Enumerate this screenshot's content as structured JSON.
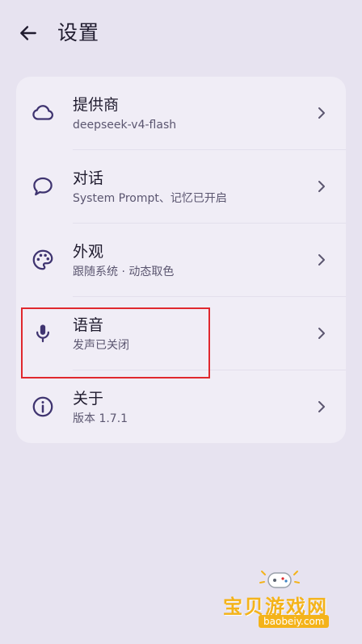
{
  "header": {
    "title": "设置",
    "back_icon": "arrow-left-icon"
  },
  "settings": {
    "items": [
      {
        "id": "provider",
        "icon": "cloud-icon",
        "title": "提供商",
        "subtitle": "deepseek-v4-flash"
      },
      {
        "id": "chat",
        "icon": "chat-bubble-icon",
        "title": "对话",
        "subtitle": "System Prompt、记忆已开启"
      },
      {
        "id": "appearance",
        "icon": "palette-icon",
        "title": "外观",
        "subtitle": "跟随系统 · 动态取色"
      },
      {
        "id": "voice",
        "icon": "microphone-icon",
        "title": "语音",
        "subtitle": "发声已关闭"
      },
      {
        "id": "about",
        "icon": "info-icon",
        "title": "关于",
        "subtitle": "版本 1.7.1"
      }
    ]
  },
  "watermark": {
    "text": "宝贝游戏网",
    "url": "baobeiy.com"
  },
  "colors": {
    "background": "#e7e3f0",
    "card": "#f0edf6",
    "icon": "#3f3470",
    "highlight_border": "#e0282e",
    "watermark": "#f4b31a"
  }
}
